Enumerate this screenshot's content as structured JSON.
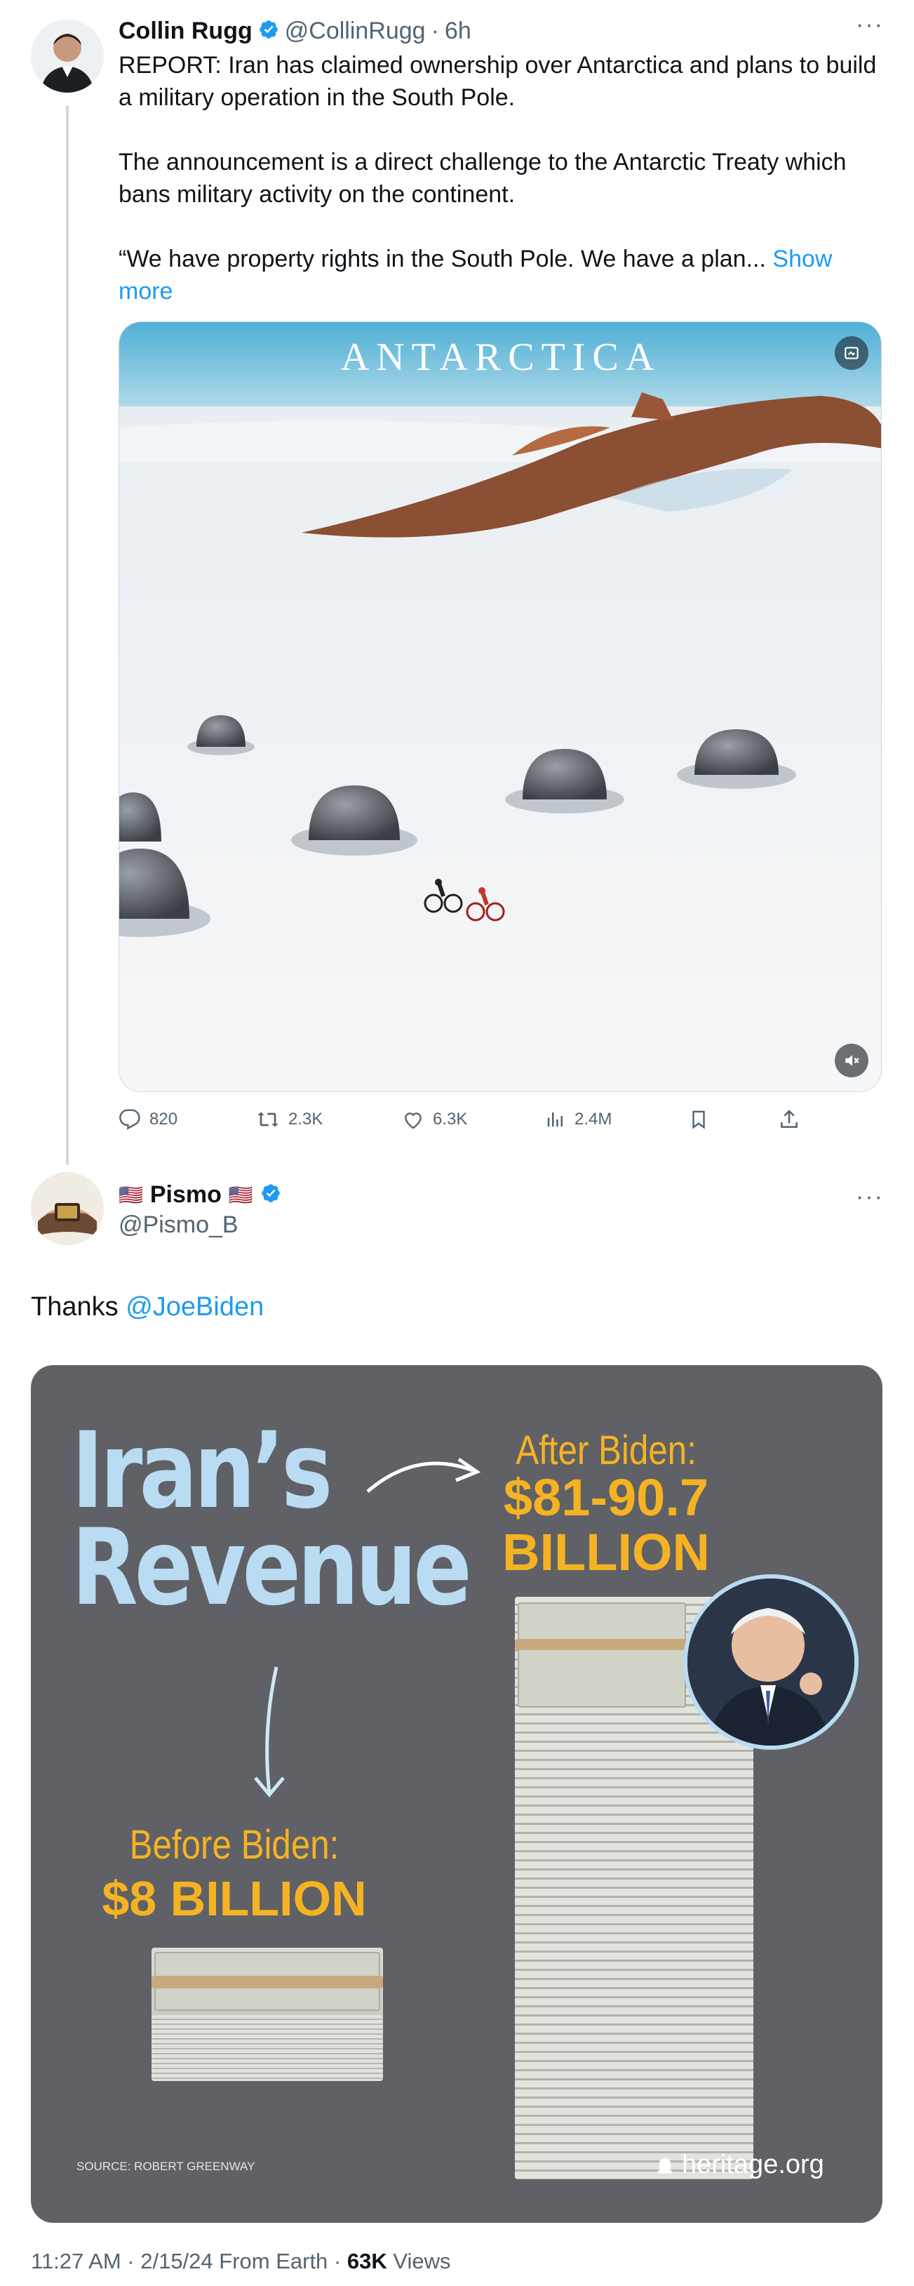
{
  "tweet1": {
    "author_name": "Collin Rugg",
    "handle": "@CollinRugg",
    "separator": "·",
    "time": "6h",
    "para1": "REPORT: Iran has claimed ownership over Antarctica and plans to build a military operation in the South Pole.",
    "para2": "The announcement is a direct challenge to the Antarctic Treaty which bans military activity on the continent.",
    "para3": "“We have property rights in the South Pole. We have a plan...",
    "show_more": "Show more",
    "media_title": "ANTARCTICA",
    "replies": "820",
    "retweets": "2.3K",
    "likes": "6.3K",
    "views": "2.4M"
  },
  "tweet2": {
    "author_flag_left": "🇺🇸",
    "author_name": "Pismo",
    "author_flag_right": "🇺🇸",
    "handle": "@Pismo_B",
    "text_prefix": "Thanks",
    "mention": "@JoeBiden",
    "infographic": {
      "title_line1": "Iran’s",
      "title_line2": "Revenue",
      "after_label": "After Biden:",
      "after_value_line1": "$81-90.7",
      "after_value_line2": "BILLION",
      "before_label": "Before Biden:",
      "before_value": "$8 BILLION",
      "source": "SOURCE: ROBERT GREENWAY",
      "brand": "heritage.org"
    },
    "timestamp": "11:27 AM · 2/15/24 From Earth ·",
    "views_count": "63K",
    "views_label": "Views"
  },
  "colors": {
    "link": "#1d9bf0",
    "verified": "#1d9bf0",
    "infographic_bg": "#5f6166",
    "infographic_title": "#b9dcf2",
    "infographic_value": "#f5b324"
  },
  "icons": [
    "more-icon",
    "verified-icon",
    "reply-icon",
    "retweet-icon",
    "like-icon",
    "views-icon",
    "bookmark-icon",
    "share-icon",
    "mute-icon",
    "media-badge-icon",
    "arrow-icon",
    "bell-icon"
  ]
}
